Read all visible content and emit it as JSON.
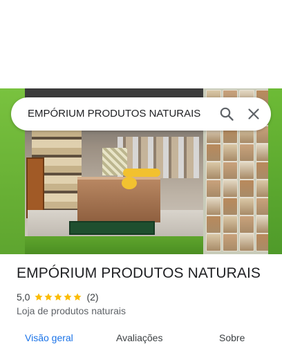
{
  "search": {
    "query": "EMPÓRIUM PRODUTOS NATURAIS"
  },
  "place": {
    "name": "EMPÓRIUM PRODUTOS NATURAIS",
    "rating": "5,0",
    "stars": 5,
    "review_count": "(2)",
    "category": "Loja de produtos naturais"
  },
  "tabs": [
    {
      "label": "Visão geral",
      "active": true
    },
    {
      "label": "Avaliações",
      "active": false
    },
    {
      "label": "Sobre",
      "active": false
    }
  ],
  "colors": {
    "accent": "#1a73e8",
    "star": "#fbbc04",
    "text_primary": "#202124",
    "text_secondary": "#5f6368"
  },
  "icons": {
    "search": "search-icon",
    "close": "close-icon",
    "star": "star-icon"
  }
}
